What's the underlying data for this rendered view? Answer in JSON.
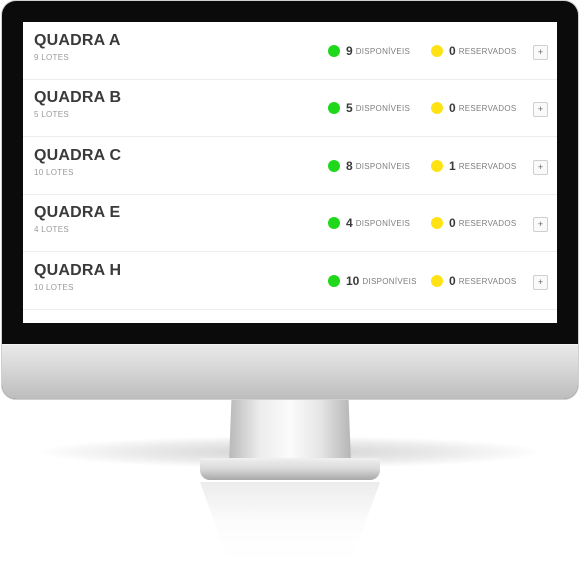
{
  "lists": {
    "available_label": "DISPONÍVEIS",
    "reserved_label": "RESERVADOS",
    "expand_symbol": "+",
    "quadras": [
      {
        "name": "QUADRA A",
        "lotes": "9 LOTES",
        "disponiveis": "9",
        "reservados": "0"
      },
      {
        "name": "QUADRA B",
        "lotes": "5 LOTES",
        "disponiveis": "5",
        "reservados": "0"
      },
      {
        "name": "QUADRA C",
        "lotes": "10 LOTES",
        "disponiveis": "8",
        "reservados": "1"
      },
      {
        "name": "QUADRA E",
        "lotes": "4 LOTES",
        "disponiveis": "4",
        "reservados": "0"
      },
      {
        "name": "QUADRA H",
        "lotes": "10 LOTES",
        "disponiveis": "10",
        "reservados": "0"
      }
    ]
  },
  "colors": {
    "available_dot": "#1fd81c",
    "reserved_dot": "#ffe214",
    "title_text": "#3a3a3a"
  },
  "icons": {
    "available": "green-dot-icon",
    "reserved": "yellow-dot-icon",
    "expand": "plus-icon"
  }
}
